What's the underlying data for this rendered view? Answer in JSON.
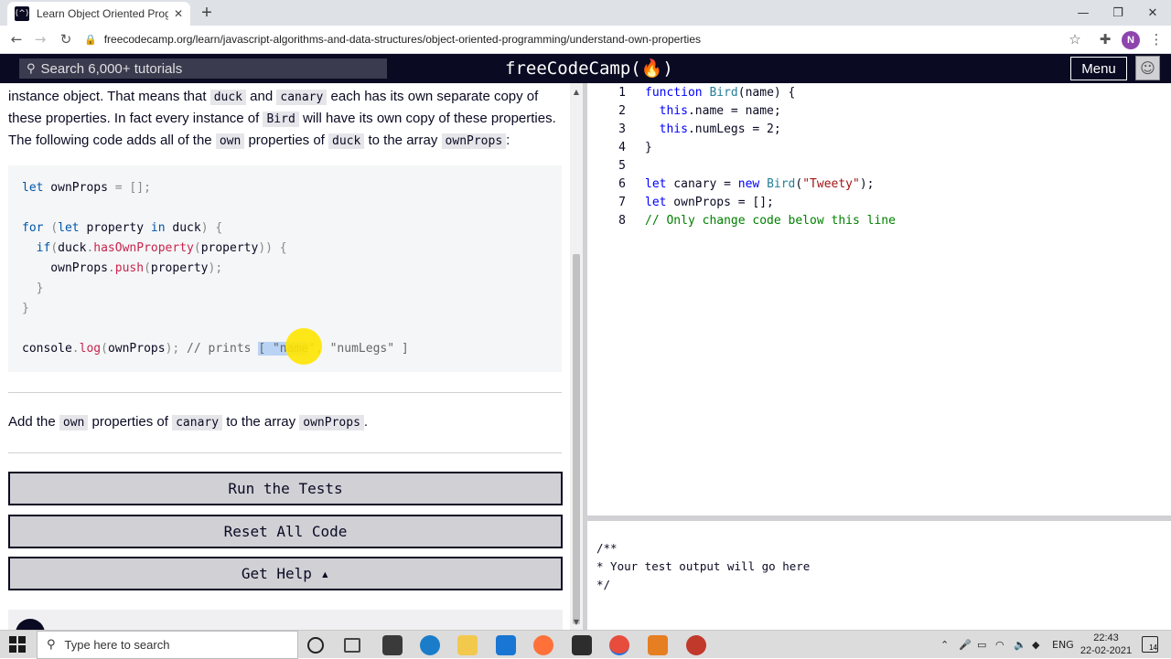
{
  "browser": {
    "tab_title": "Learn Object Oriented Programm",
    "tab_close": "✕",
    "new_tab": "+",
    "url": "freecodecamp.org/learn/javascript-algorithms-and-data-structures/object-oriented-programming/understand-own-properties",
    "profile_initial": "N"
  },
  "fcc": {
    "search_placeholder": "Search 6,000+ tutorials",
    "logo": "freeCodeCamp(🔥)",
    "menu_label": "Menu"
  },
  "lesson": {
    "para1": {
      "t1": "instance object. That means that ",
      "c1": "duck",
      "t2": " and ",
      "c2": "canary",
      "t3": " each has its own separate copy of these properties. In fact every instance of ",
      "c3": "Bird",
      "t4": " will have its own copy of these properties. The following code adds all of the ",
      "c4": "own",
      "t5": " properties of ",
      "c5": "duck",
      "t6": " to the array ",
      "c6": "ownProps",
      "t7": ":"
    },
    "task": {
      "t1": "Add the ",
      "c1": "own",
      "t2": " properties of ",
      "c2": "canary",
      "t3": " to the array ",
      "c3": "ownProps",
      "t4": "."
    },
    "buttons": {
      "run": "Run the Tests",
      "reset": "Reset All Code",
      "help": "Get Help ▴"
    }
  },
  "editor": {
    "line_numbers": [
      "1",
      "2",
      "3",
      "4",
      "5",
      "6",
      "7",
      "8"
    ]
  },
  "output": {
    "lines": [
      "/**",
      "* Your test output will go here",
      "*/"
    ]
  },
  "taskbar": {
    "search_placeholder": "Type here to search",
    "lang": "ENG",
    "time": "22:43",
    "date": "22-02-2021",
    "notifications": "14"
  }
}
